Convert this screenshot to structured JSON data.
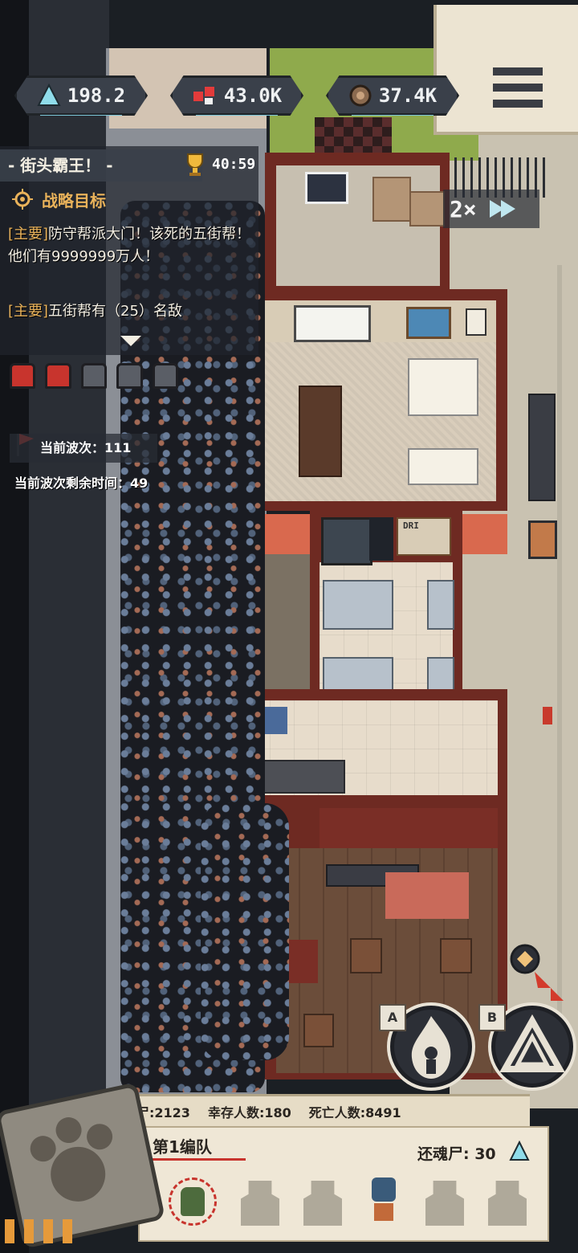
{
  "resources": {
    "wood": {
      "value": "198.2",
      "icon": "triangle-crystal-icon"
    },
    "medical": {
      "value": "43.0K",
      "icon": "medkit-icon"
    },
    "food": {
      "value": "37.4K",
      "icon": "food-can-icon"
    }
  },
  "mission": {
    "title": "- 街头霸王！ -",
    "timer": "40:59",
    "objectives_header": "战略目标",
    "objectives": [
      {
        "tag": "[主要]",
        "text": "防守帮派大门！该死的五街帮！他们有9999999万人！"
      },
      {
        "tag": "[主要]",
        "text": "五街帮有（25）名敌"
      }
    ]
  },
  "defenses": {
    "active": 2,
    "total": 5
  },
  "wave": {
    "current_label": "当前波次：111",
    "remaining_label": "当前波次剩余时间：49"
  },
  "speed": {
    "label": "2×"
  },
  "room_sign": "DRI",
  "stats_bar": {
    "zombies": "丧尸:2123",
    "survivors": "幸存人数:180",
    "dead": "死亡人数:8491"
  },
  "squad": {
    "name": "第1编队",
    "revive": "还魂尸: 30"
  },
  "ability_buttons": [
    {
      "key": "A",
      "icon": "flame-silhouette-icon"
    },
    {
      "key": "B",
      "icon": "tent-icon"
    }
  ],
  "colors": {
    "accent": "#e9b25a",
    "brand_red": "#c8342d",
    "ui_dark": "#3a404a",
    "resource_bar": "#7cc6d8"
  }
}
